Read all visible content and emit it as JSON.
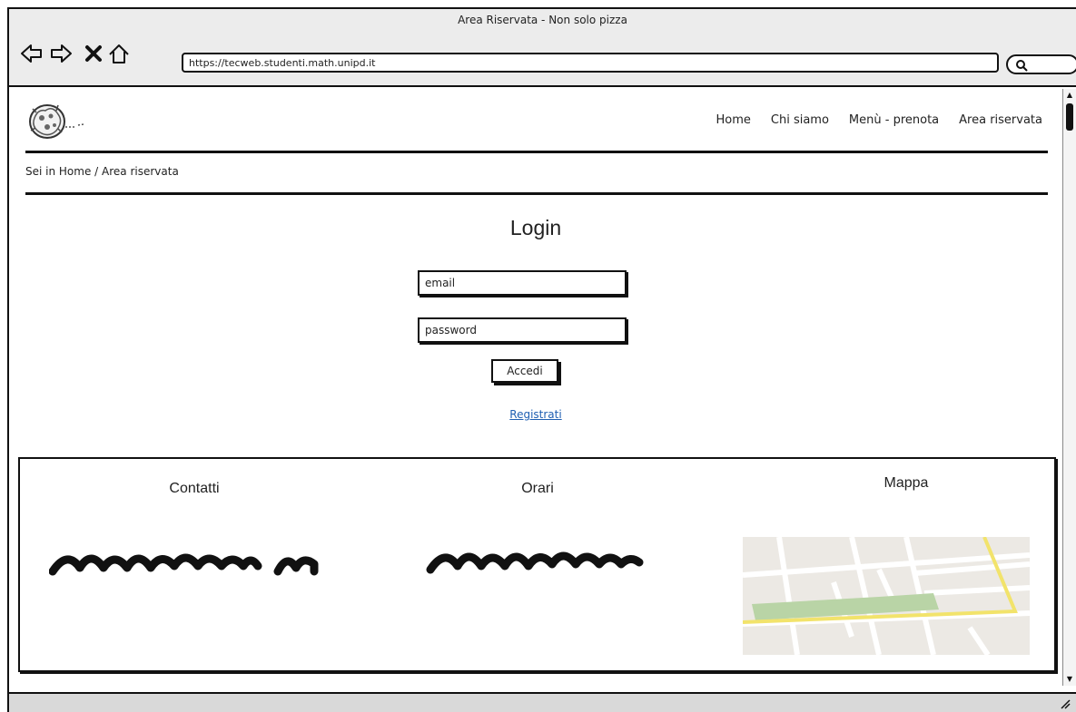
{
  "window": {
    "title": "Area Riservata - Non solo pizza",
    "url": "https://tecweb.studenti.math.unipd.it"
  },
  "nav": {
    "items": [
      {
        "label": "Home"
      },
      {
        "label": "Chi siamo"
      },
      {
        "label": "Menù - prenota"
      },
      {
        "label": "Area riservata"
      }
    ]
  },
  "breadcrumb": "Sei in Home / Area riservata",
  "login": {
    "title": "Login",
    "email_placeholder": "email",
    "password_placeholder": "password",
    "submit_label": "Accedi",
    "register_link": "Registrati"
  },
  "footer": {
    "contacts_title": "Contatti",
    "hours_title": "Orari",
    "map_title": "Mappa"
  },
  "colors": {
    "link": "#1f5fb2",
    "chrome": "#ececec",
    "map_green": "#b9d4a6",
    "map_road": "#f2e36b"
  }
}
